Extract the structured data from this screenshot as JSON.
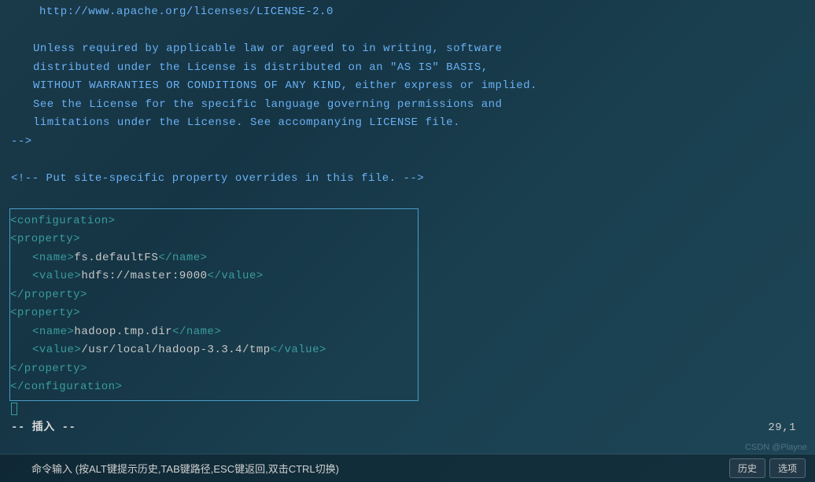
{
  "license": {
    "url": "http://www.apache.org/licenses/LICENSE-2.0",
    "line1": "Unless required by applicable law or agreed to in writing, software",
    "line2": "distributed under the License is distributed on an \"AS IS\" BASIS,",
    "line3": "WITHOUT WARRANTIES OR CONDITIONS OF ANY KIND, either express or implied.",
    "line4": "See the License for the specific language governing permissions and",
    "line5": "limitations under the License. See accompanying LICENSE file.",
    "close": "-->"
  },
  "comment_line": "<!-- Put site-specific property overrides in this file. -->",
  "config": {
    "open_config": "<configuration>",
    "open_prop": "<property>",
    "open_name": "<name>",
    "close_name": "</name>",
    "open_value": "<value>",
    "close_value": "</value>",
    "close_prop": "</property>",
    "close_config": "</configuration>",
    "prop1": {
      "name": "fs.defaultFS",
      "value": "hdfs://master:9000"
    },
    "prop2": {
      "name": "hadoop.tmp.dir",
      "value": "/usr/local/hadoop-3.3.4/tmp"
    }
  },
  "status": {
    "mode_prefix": "-- ",
    "mode": "插入",
    "mode_suffix": " --",
    "position": "29,1"
  },
  "bottom": {
    "prompt": "命令输入 (按ALT键提示历史,TAB键路径,ESC键返回,双击CTRL切换)",
    "history": "历史",
    "options": "选项"
  },
  "watermark": "CSDN @Playne"
}
